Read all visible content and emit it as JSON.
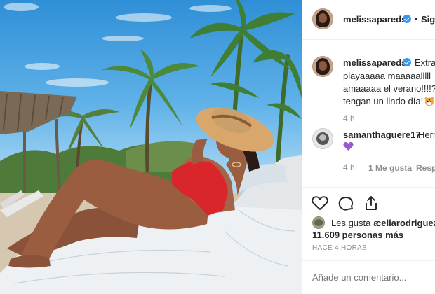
{
  "post": {
    "author": "melissapareds",
    "follow_label": "Sigu",
    "separator": "•",
    "caption_author": "melissapareds",
    "caption_lines": [
      "Extran",
      "playaaaaa maaaaalllll",
      "amaaaaa el verano!!!!??",
      "tengan un lindo día! "
    ],
    "caption_time": "4 h",
    "comment": {
      "author": "samanthaguere17",
      "text": "Herr",
      "time": "4 h",
      "likes": "1 Me gusta",
      "reply": "Respo"
    },
    "likes_prefix": "Les gusta a",
    "likes_user": "celiarodriguezt",
    "likes_count": "11.609 personas más",
    "posted_ago": "HACE 4 HORAS",
    "comment_placeholder": "Añade un comentario..."
  },
  "icons": {
    "verified": "verified-badge-icon",
    "like": "heart-outline-icon",
    "comment": "comment-bubble-icon",
    "share": "share-arrow-icon",
    "emoji": "tiger-face-emoji-icon",
    "purple_heart": "purple-heart-icon"
  },
  "colors": {
    "verified_blue": "#3897f0",
    "text": "#262626",
    "muted": "#8e8e8e",
    "purple_heart": "#9b59d0"
  }
}
